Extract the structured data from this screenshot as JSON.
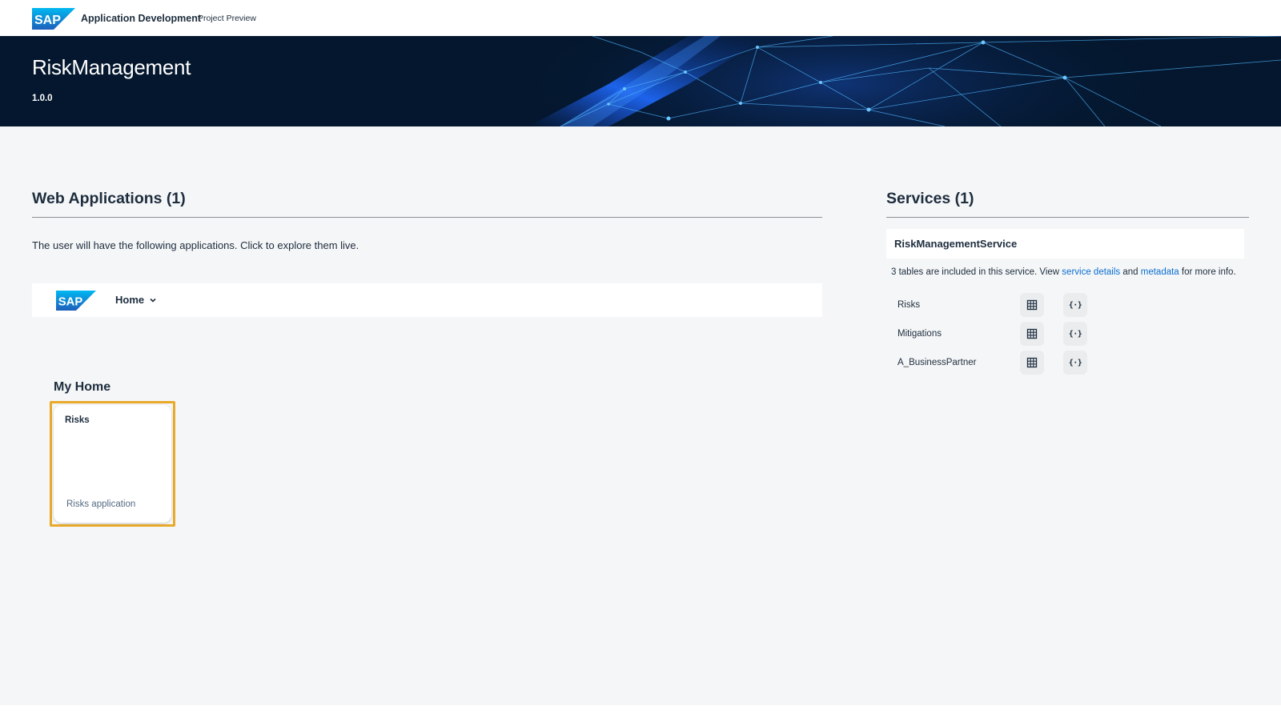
{
  "topbar": {
    "logo": "SAP",
    "app_title": "Application Development",
    "app_subtitle": "Project Preview"
  },
  "banner": {
    "project_name": "RiskManagement",
    "version": "1.0.0"
  },
  "web_applications": {
    "heading": "Web Applications (1)",
    "description": "The user will have the following applications. Click to explore them live.",
    "launchpad": {
      "logo": "SAP",
      "menu_label": "Home"
    },
    "group_title": "My Home",
    "tiles": [
      {
        "title": "Risks",
        "subtitle": "Risks application"
      }
    ]
  },
  "services": {
    "heading": "Services (1)",
    "service_name": "RiskManagementService",
    "desc_prefix": "3 tables are included in this service. View ",
    "details_link": "service details",
    "desc_mid": " and ",
    "metadata_link": "metadata",
    "desc_suffix": " for more info.",
    "entities": [
      {
        "name": "Risks"
      },
      {
        "name": "Mitigations"
      },
      {
        "name": "A_BusinessPartner"
      }
    ]
  },
  "icons": {
    "table": "table-icon",
    "code": "code-icon",
    "chevron": "chevron-down-icon"
  },
  "colors": {
    "banner_bg": "#04172e",
    "accent_link": "#0a6ed1",
    "tile_highlight": "#e9a92a",
    "page_bg": "#f5f6f7"
  }
}
